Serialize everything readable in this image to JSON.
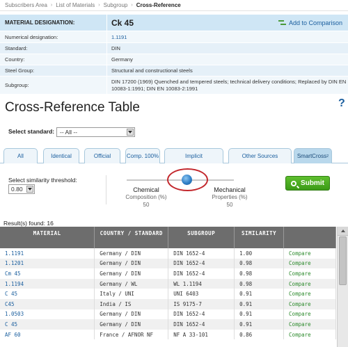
{
  "breadcrumb": {
    "items": [
      "Subscribers Area",
      "List of Materials",
      "Subgroup",
      "Cross-Reference"
    ],
    "separator": "›"
  },
  "material": {
    "designation_label": "MATERIAL DESIGNATION:",
    "designation_value": "Ck 45",
    "add_to_comparison": "Add to Comparison",
    "rows": [
      {
        "label": "Numerical designation:",
        "value": "1.1191"
      },
      {
        "label": "Standard:",
        "value": "DIN"
      },
      {
        "label": "Country:",
        "value": "Germany"
      },
      {
        "label": "Steel Group:",
        "value": "Structural and constructional steels"
      },
      {
        "label": "Subgroup:",
        "value": "DIN 17200 (1969) Quenched and tempered steels; technical delivery conditions; Replaced by DIN EN 10083-1:1991; DIN EN 10083-2:1991"
      }
    ]
  },
  "page_title": "Cross-Reference Table",
  "help_icon": "?",
  "standard_select": {
    "label": "Select standard:",
    "value": "-- All --"
  },
  "tabs": [
    {
      "label": "All"
    },
    {
      "label": "Identical"
    },
    {
      "label": "Official"
    },
    {
      "label": "Comp. 100%"
    },
    {
      "label": "Implicit"
    },
    {
      "label": "Other Sources"
    },
    {
      "label": "SmartCross",
      "sup": "2"
    }
  ],
  "similarity": {
    "label": "Select similarity threshold:",
    "value": "0.80",
    "chemical_title": "Chemical",
    "chemical_sub": "Composition (%)",
    "chemical_value": "50",
    "mechanical_title": "Mechanical",
    "mechanical_sub": "Properties (%)",
    "mechanical_value": "50",
    "submit_label": "Submit"
  },
  "results": {
    "found_text": "Result(s) found: 16",
    "columns": [
      "MATERIAL",
      "COUNTRY / STANDARD",
      "SUBGROUP",
      "SIMILARITY",
      ""
    ],
    "rows": [
      {
        "material": "1.1191",
        "country": "Germany / DIN",
        "subgroup": "DIN 1652-4",
        "similarity": "1.00",
        "action": "Compare"
      },
      {
        "material": "1.1201",
        "country": "Germany / DIN",
        "subgroup": "DIN 1652-4",
        "similarity": "0.98",
        "action": "Compare"
      },
      {
        "material": "Cm 45",
        "country": "Germany / DIN",
        "subgroup": "DIN 1652-4",
        "similarity": "0.98",
        "action": "Compare"
      },
      {
        "material": "1.1194",
        "country": "Germany / WL",
        "subgroup": "WL 1.1194",
        "similarity": "0.98",
        "action": "Compare"
      },
      {
        "material": "C 45",
        "country": "Italy / UNI",
        "subgroup": "UNI 6403",
        "similarity": "0.91",
        "action": "Compare"
      },
      {
        "material": "C45",
        "country": "India / IS",
        "subgroup": "IS 9175-7",
        "similarity": "0.91",
        "action": "Compare"
      },
      {
        "material": "1.0503",
        "country": "Germany / DIN",
        "subgroup": "DIN 1652-4",
        "similarity": "0.91",
        "action": "Compare"
      },
      {
        "material": "C 45",
        "country": "Germany / DIN",
        "subgroup": "DIN 1652-4",
        "similarity": "0.91",
        "action": "Compare"
      },
      {
        "material": "AF 60",
        "country": "France / AFNOR NF",
        "subgroup": "NF A 33-101",
        "similarity": "0.86",
        "action": "Compare"
      }
    ]
  },
  "colors": {
    "header_blue": "#cfe6f5",
    "link_blue": "#1a5e9e",
    "compare_green": "#2e8b2e",
    "submit_green": "#3b9a17",
    "highlight_red": "#c3282d",
    "table_header": "#6d6d6d"
  }
}
